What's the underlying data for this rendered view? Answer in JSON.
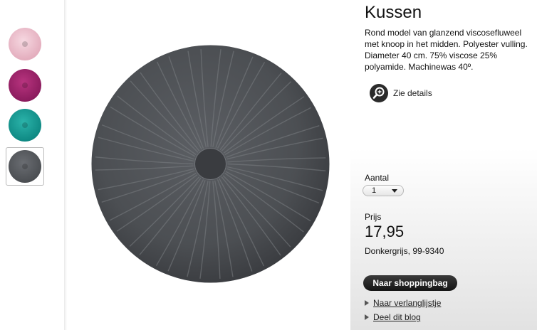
{
  "thumbnails": [
    {
      "color": "#e8b9c6",
      "selected": false
    },
    {
      "color": "#8c1c5e",
      "selected": false
    },
    {
      "color": "#0f8a84",
      "selected": false
    },
    {
      "color": "#4c4f53",
      "selected": true
    }
  ],
  "product": {
    "title": "Kussen",
    "description": "Rond model van glanzend viscosefluweel met knoop in het midden. Polyester vulling. Diameter 40 cm. 75% viscose 25% polyamide. Machinewas 40º.",
    "details_link": "Zie details",
    "quantity_label": "Aantal",
    "quantity_value": "1",
    "price_label": "Prijs",
    "price": "17,95",
    "color_article": "Donkergrijs, 99-9340",
    "add_to_bag": "Naar shoppingbag",
    "wishlist_link": "Naar verlanglijstje",
    "blog_link": "Deel dit blog"
  },
  "colors": {
    "cushion_main": "#4c4f53",
    "cushion_dark": "#2e3033",
    "button_bg": "#1e1e1e"
  },
  "icons": {
    "details": "magnifier-plus-icon",
    "link_bullet": "triangle-right-icon",
    "dropdown": "chevron-down-icon"
  }
}
